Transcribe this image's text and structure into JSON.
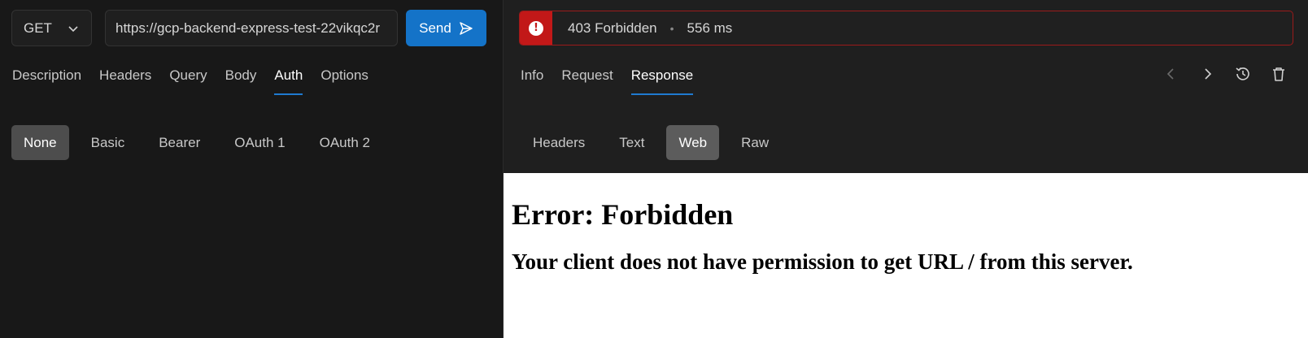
{
  "request": {
    "method": "GET",
    "url": "https://gcp-backend-express-test-22vikqc2r",
    "send_label": "Send",
    "tabs": [
      "Description",
      "Headers",
      "Query",
      "Body",
      "Auth",
      "Options"
    ],
    "active_tab": "Auth",
    "auth_options": [
      "None",
      "Basic",
      "Bearer",
      "OAuth 1",
      "OAuth 2"
    ],
    "active_auth": "None"
  },
  "response": {
    "status": "403 Forbidden",
    "separator": "•",
    "time": "556 ms",
    "tabs": [
      "Info",
      "Request",
      "Response"
    ],
    "active_tab": "Response",
    "view_tabs": [
      "Headers",
      "Text",
      "Web",
      "Raw"
    ],
    "active_view": "Web",
    "web": {
      "heading": "Error: Forbidden",
      "message": "Your client does not have permission to get URL / from this server."
    }
  },
  "colors": {
    "accent": "#1473c8",
    "error": "#c21818",
    "tab_underline": "#1f7ad0"
  },
  "icons": {
    "method_dropdown": "chevron-down-icon",
    "send": "send-icon",
    "status": "error-icon",
    "prev": "chevron-left-icon",
    "next": "chevron-right-icon",
    "history": "history-icon",
    "delete": "trash-icon"
  }
}
